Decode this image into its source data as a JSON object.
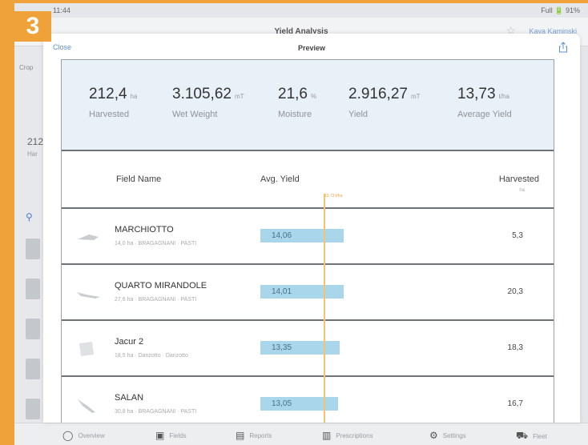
{
  "step_number": "3",
  "status_bar": {
    "time": "11:44",
    "signal": "Full 🔋 91%"
  },
  "background_app": {
    "title": "Yield Analysis",
    "right_link": "Kaya Kaminski",
    "left_tab": "Crop",
    "left_value": "212",
    "left_sub": "Har",
    "right_value": "",
    "tabs": [
      {
        "icon": "circle-icon",
        "label": "Overview"
      },
      {
        "icon": "field-icon",
        "label": "Fields"
      },
      {
        "icon": "report-icon",
        "label": "Reports"
      },
      {
        "icon": "recommendation-icon",
        "label": "Prescriptions"
      },
      {
        "icon": "settings-icon",
        "label": "Settings"
      },
      {
        "icon": "tractor-icon",
        "label": "Fleet"
      }
    ]
  },
  "modal": {
    "close_label": "Close",
    "title": "Preview",
    "summary": [
      {
        "value": "212,4",
        "unit": "ha",
        "label": "Harvested"
      },
      {
        "value": "3.105,62",
        "unit": "mT",
        "label": "Wet Weight"
      },
      {
        "value": "21,6",
        "unit": "%",
        "label": "Moisture"
      },
      {
        "value": "2.916,27",
        "unit": "mT",
        "label": "Yield"
      },
      {
        "value": "13,73",
        "unit": "t/ha",
        "label": "Average Yield"
      }
    ],
    "columns": {
      "field_name": "Field Name",
      "avg_yield": "Avg. Yield",
      "avg_marker": "13,73 t/ha",
      "harvested": "Harvested",
      "harvested_unit": "ha"
    },
    "rows": [
      {
        "name": "MARCHIOTTO",
        "sub": "14,0 ha · BRAGAGNANI · PASTI",
        "yield": "14,06",
        "yield_value": 14.06,
        "harvested": "5,3"
      },
      {
        "name": "QUARTO MIRANDOLE",
        "sub": "27,6 ha · BRAGAGNANI · PASTI",
        "yield": "14,01",
        "yield_value": 14.01,
        "harvested": "20,3"
      },
      {
        "name": "Jacur 2",
        "sub": "18,5 ha · Danzotto · Danzotto",
        "yield": "13,35",
        "yield_value": 13.35,
        "harvested": "18,3"
      },
      {
        "name": "SALAN",
        "sub": "30,8 ha · BRAGAGNANI · PASTI",
        "yield": "13,05",
        "yield_value": 13.05,
        "harvested": "16,7"
      }
    ]
  },
  "colors": {
    "frame": "#f0a23a",
    "bar": "#a9d6ea",
    "average_line": "#f5c36e",
    "link": "#5b8ed0"
  }
}
